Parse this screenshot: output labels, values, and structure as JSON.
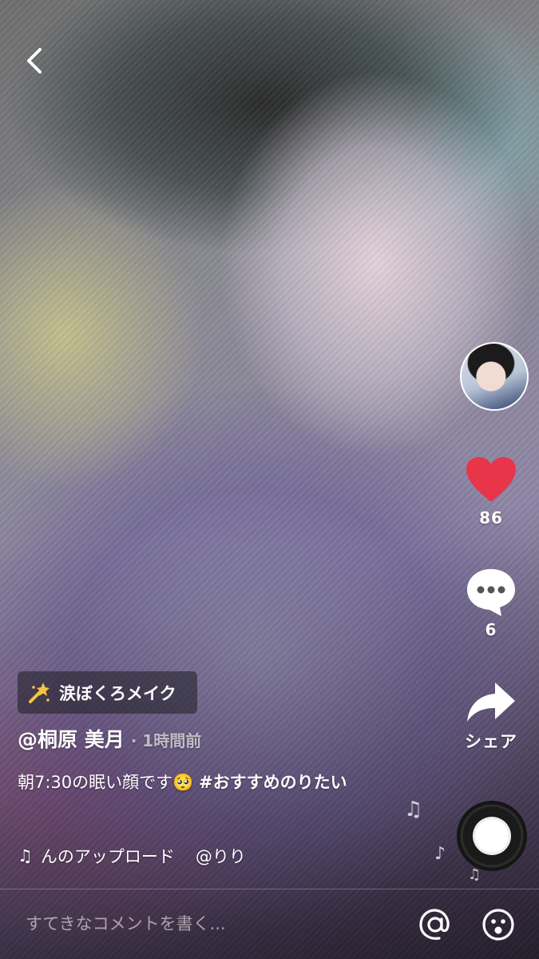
{
  "video": {
    "effect": {
      "icon": "sparkle-wand-icon",
      "label": "涙ぼくろメイク"
    },
    "author": "@桐原 美月",
    "time_ago": "· 1時間前",
    "caption_text": "朝7:30の眠い顔です",
    "caption_emoji": "🥺",
    "caption_hashtag": "#おすすめのりたい",
    "music": {
      "icon": "♫",
      "title": "んのアップロード",
      "artist": "@りり"
    }
  },
  "actions": {
    "likes": "86",
    "comments": "6",
    "share_label": "シェア"
  },
  "comment_bar": {
    "placeholder": "すてきなコメントを書く..."
  },
  "colors": {
    "like": "#e8354a",
    "text": "#ffffff"
  }
}
